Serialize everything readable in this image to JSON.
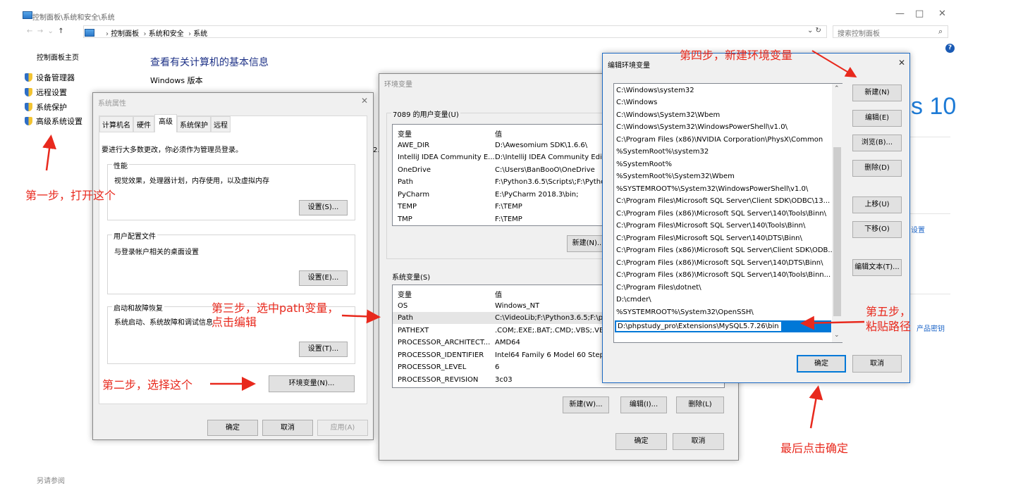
{
  "window": {
    "title": "控制面板\\系统和安全\\系统",
    "breadcrumbs": [
      "控制面板",
      "系统和安全",
      "系统"
    ],
    "search_placeholder": "搜索控制面板",
    "minimize": "—",
    "maximize": "□",
    "close": "✕"
  },
  "sidebar": {
    "home": "控制面板主页",
    "items": [
      {
        "label": "设备管理器"
      },
      {
        "label": "远程设置"
      },
      {
        "label": "系统保护"
      },
      {
        "label": "高级系统设置"
      }
    ]
  },
  "main": {
    "heading": "查看有关计算机的基本信息",
    "windows_edition": "Windows 版本",
    "win10_text": "s 10",
    "partial_link_1": "设置",
    "partial_link_2": "产品密钥",
    "partial_number": "2."
  },
  "system_properties": {
    "title": "系统属性",
    "tabs": [
      "计算机名",
      "硬件",
      "高级",
      "系统保护",
      "远程"
    ],
    "admin_note": "要进行大多数更改，你必须作为管理员登录。",
    "performance": {
      "label": "性能",
      "desc": "视觉效果，处理器计划，内存使用，以及虚拟内存",
      "button": "设置(S)..."
    },
    "user_profiles": {
      "label": "用户配置文件",
      "desc": "与登录帐户相关的桌面设置",
      "button": "设置(E)..."
    },
    "startup": {
      "label": "启动和故障恢复",
      "desc": "系统启动、系统故障和调试信息",
      "button": "设置(T)..."
    },
    "env_button": "环境变量(N)...",
    "ok": "确定",
    "cancel": "取消",
    "apply": "应用(A)"
  },
  "env_vars": {
    "title": "环境变量",
    "user_section": "7089 的用户变量(U)",
    "col_var": "变量",
    "col_val": "值",
    "user_vars": [
      {
        "name": "AWE_DIR",
        "value": "D:\\Awesomium SDK\\1.6.6\\"
      },
      {
        "name": "IntelliJ IDEA Community E...",
        "value": "D:\\IntelliJ IDEA Community Edit"
      },
      {
        "name": "OneDrive",
        "value": "C:\\Users\\BanBooO\\OneDrive"
      },
      {
        "name": "Path",
        "value": "F:\\Python3.6.5\\Scripts\\;F:\\Pytho"
      },
      {
        "name": "PyCharm",
        "value": "E:\\PyCharm 2018.3\\bin;"
      },
      {
        "name": "TEMP",
        "value": "F:\\TEMP"
      },
      {
        "name": "TMP",
        "value": "F:\\TEMP"
      }
    ],
    "user_new": "新建(N)...",
    "system_section": "系统变量(S)",
    "system_vars": [
      {
        "name": "OS",
        "value": "Windows_NT"
      },
      {
        "name": "Path",
        "value": "C:\\VideoLib;F:\\Python3.6.5;F:\\py"
      },
      {
        "name": "PATHEXT",
        "value": ".COM;.EXE;.BAT;.CMD;.VBS;.VBE"
      },
      {
        "name": "PROCESSOR_ARCHITECT...",
        "value": "AMD64"
      },
      {
        "name": "PROCESSOR_IDENTIFIER",
        "value": "Intel64 Family 6 Model 60 Step"
      },
      {
        "name": "PROCESSOR_LEVEL",
        "value": "6"
      },
      {
        "name": "PROCESSOR_REVISION",
        "value": "3c03"
      }
    ],
    "sys_new": "新建(W)...",
    "sys_edit": "编辑(I)...",
    "sys_delete": "删除(L)",
    "ok": "确定",
    "cancel": "取消"
  },
  "edit_env": {
    "title": "编辑环境变量",
    "paths": [
      "C:\\Windows\\system32",
      "C:\\Windows",
      "C:\\Windows\\System32\\Wbem",
      "C:\\Windows\\System32\\WindowsPowerShell\\v1.0\\",
      "C:\\Program Files (x86)\\NVIDIA Corporation\\PhysX\\Common",
      "%SystemRoot%\\system32",
      "%SystemRoot%",
      "%SystemRoot%\\System32\\Wbem",
      "%SYSTEMROOT%\\System32\\WindowsPowerShell\\v1.0\\",
      "C:\\Program Files\\Microsoft SQL Server\\Client SDK\\ODBC\\13...",
      "C:\\Program Files (x86)\\Microsoft SQL Server\\140\\Tools\\Binn\\",
      "C:\\Program Files\\Microsoft SQL Server\\140\\Tools\\Binn\\",
      "C:\\Program Files\\Microsoft SQL Server\\140\\DTS\\Binn\\",
      "C:\\Program Files (x86)\\Microsoft SQL Server\\Client SDK\\ODB...",
      "C:\\Program Files (x86)\\Microsoft SQL Server\\140\\DTS\\Binn\\",
      "C:\\Program Files (x86)\\Microsoft SQL Server\\140\\Tools\\Binn...",
      "C:\\Program Files\\dotnet\\",
      "D:\\cmder\\",
      "%SYSTEMROOT%\\System32\\OpenSSH\\"
    ],
    "editing_value": "D:\\phpstudy_pro\\Extensions\\MySQL5.7.26\\bin",
    "buttons": {
      "new": "新建(N)",
      "edit": "编辑(E)",
      "browse": "浏览(B)...",
      "delete": "删除(D)",
      "up": "上移(U)",
      "down": "下移(O)",
      "edit_text": "编辑文本(T)..."
    },
    "ok": "确定",
    "cancel": "取消"
  },
  "annotations": {
    "step1": "第一步，打开这个",
    "step2": "第二步，选择这个",
    "step3_line1": "第三步，选中path变量，",
    "step3_line2": "点击编辑",
    "step4": "第四步，新建环境变量",
    "step5_line1": "第五步，",
    "step5_line2": "粘贴路径",
    "final": "最后点击确定"
  },
  "footer_partial": "另请参阅"
}
